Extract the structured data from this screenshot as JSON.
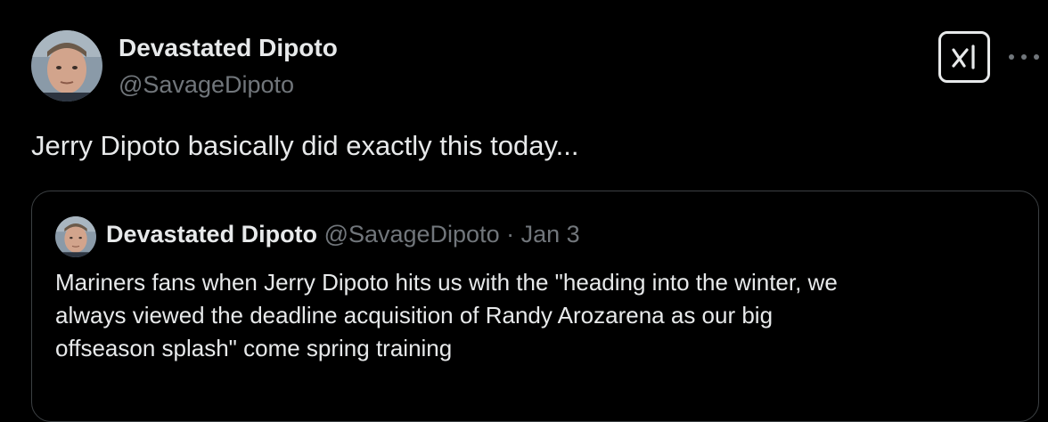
{
  "post": {
    "display_name": "Devastated Dipoto",
    "handle": "@SavageDipoto",
    "text": "Jerry Dipoto basically did exactly this today..."
  },
  "header_actions": {
    "grok_icon": "grok-logo-icon",
    "more_icon": "more-horizontal-icon"
  },
  "quoted_post": {
    "display_name": "Devastated Dipoto",
    "handle": "@SavageDipoto",
    "separator": "·",
    "date": "Jan 3",
    "text_lines": [
      "Mariners fans when Jerry Dipoto hits us with the \"heading into the winter, we",
      "always viewed the deadline acquisition of Randy Arozarena as our big",
      "offseason splash\" come spring training"
    ]
  },
  "colors": {
    "background": "#000000",
    "primary_text": "#e7e9ea",
    "secondary_text": "#71767b",
    "border": "#3c4043"
  }
}
